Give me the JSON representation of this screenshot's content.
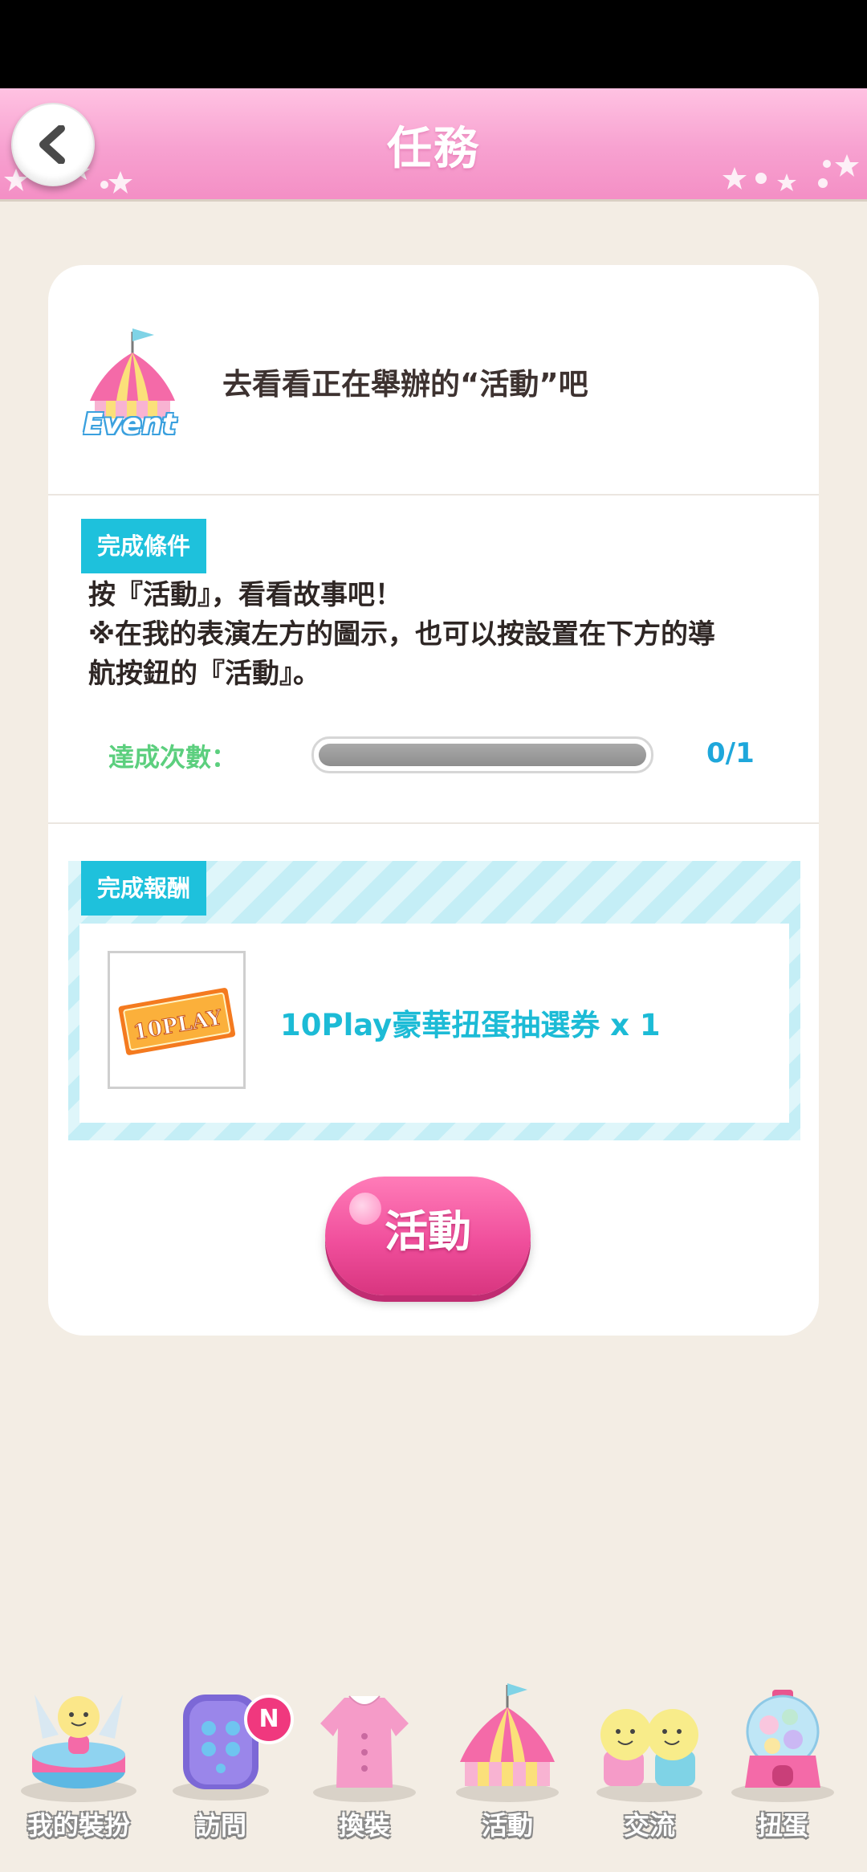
{
  "header": {
    "title": "任務"
  },
  "mission": {
    "icon_label": "Event",
    "title": "去看看正在舉辦的“活動”吧",
    "condition_tag": "完成條件",
    "condition_line1": "按『活動』，看看故事吧！",
    "condition_line2": "※在我的表演左方的圖示，也可以按設置在下方的導",
    "condition_line3": "航按鈕的『活動』。",
    "progress_label": "達成次數：",
    "progress_value": 0,
    "progress_total": 1,
    "progress_text": "0/1"
  },
  "reward": {
    "tag": "完成報酬",
    "item_name": "10Play豪華扭蛋抽選券 x 1",
    "ticket_text": "10PLAY"
  },
  "action_button": {
    "label": "活動"
  },
  "nav": {
    "items": [
      {
        "label": "我的裝扮",
        "icon": "stage-doll-icon"
      },
      {
        "label": "訪問",
        "icon": "door-icon",
        "badge": "N"
      },
      {
        "label": "換裝",
        "icon": "dress-icon"
      },
      {
        "label": "活動",
        "icon": "circus-tent-icon"
      },
      {
        "label": "交流",
        "icon": "two-friends-icon"
      },
      {
        "label": "扭蛋",
        "icon": "gacha-machine-icon"
      }
    ]
  },
  "colors": {
    "header_pink": "#f7a1d0",
    "accent_cyan": "#1ec1dc",
    "progress_green": "#5ccf7e",
    "button_pink": "#f04f9c",
    "background": "#f3ede4"
  }
}
